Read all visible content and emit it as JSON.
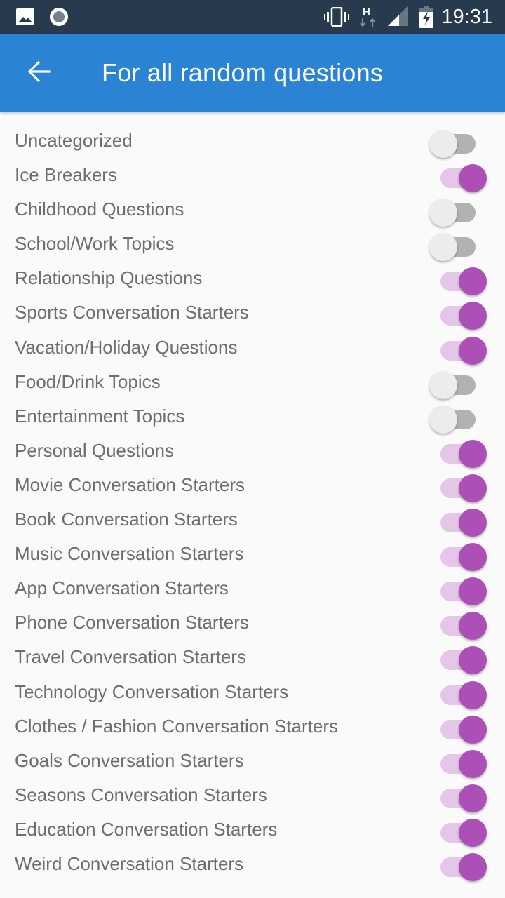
{
  "status_bar": {
    "time": "19:31",
    "icons": [
      "image-icon",
      "record-icon",
      "vibrate-icon",
      "network-h-icon",
      "signal-icon",
      "battery-charging-icon"
    ]
  },
  "app_bar": {
    "title": "For all random questions",
    "back_icon": "arrow-back-icon"
  },
  "colors": {
    "status_bar": "#283a4e",
    "app_bar": "#2b84d3",
    "switch_on_thumb": "#ac50b8",
    "switch_on_track": "#e4c6e8",
    "switch_off_thumb": "#ececec",
    "switch_off_track": "#b2b2b2"
  },
  "categories": [
    {
      "label": "Uncategorized",
      "enabled": false
    },
    {
      "label": "Ice Breakers",
      "enabled": true
    },
    {
      "label": "Childhood Questions",
      "enabled": false
    },
    {
      "label": "School/Work Topics",
      "enabled": false
    },
    {
      "label": "Relationship Questions",
      "enabled": true
    },
    {
      "label": "Sports Conversation Starters",
      "enabled": true
    },
    {
      "label": "Vacation/Holiday Questions",
      "enabled": true
    },
    {
      "label": "Food/Drink Topics",
      "enabled": false
    },
    {
      "label": "Entertainment Topics",
      "enabled": false
    },
    {
      "label": "Personal Questions",
      "enabled": true
    },
    {
      "label": "Movie Conversation Starters",
      "enabled": true
    },
    {
      "label": "Book Conversation Starters",
      "enabled": true
    },
    {
      "label": "Music Conversation Starters",
      "enabled": true
    },
    {
      "label": "App Conversation Starters",
      "enabled": true
    },
    {
      "label": "Phone Conversation Starters",
      "enabled": true
    },
    {
      "label": "Travel Conversation Starters",
      "enabled": true
    },
    {
      "label": "Technology Conversation Starters",
      "enabled": true
    },
    {
      "label": "Clothes / Fashion Conversation Starters",
      "enabled": true
    },
    {
      "label": "Goals Conversation Starters",
      "enabled": true
    },
    {
      "label": "Seasons Conversation Starters",
      "enabled": true
    },
    {
      "label": "Education Conversation Starters",
      "enabled": true
    },
    {
      "label": "Weird Conversation Starters",
      "enabled": true
    }
  ]
}
